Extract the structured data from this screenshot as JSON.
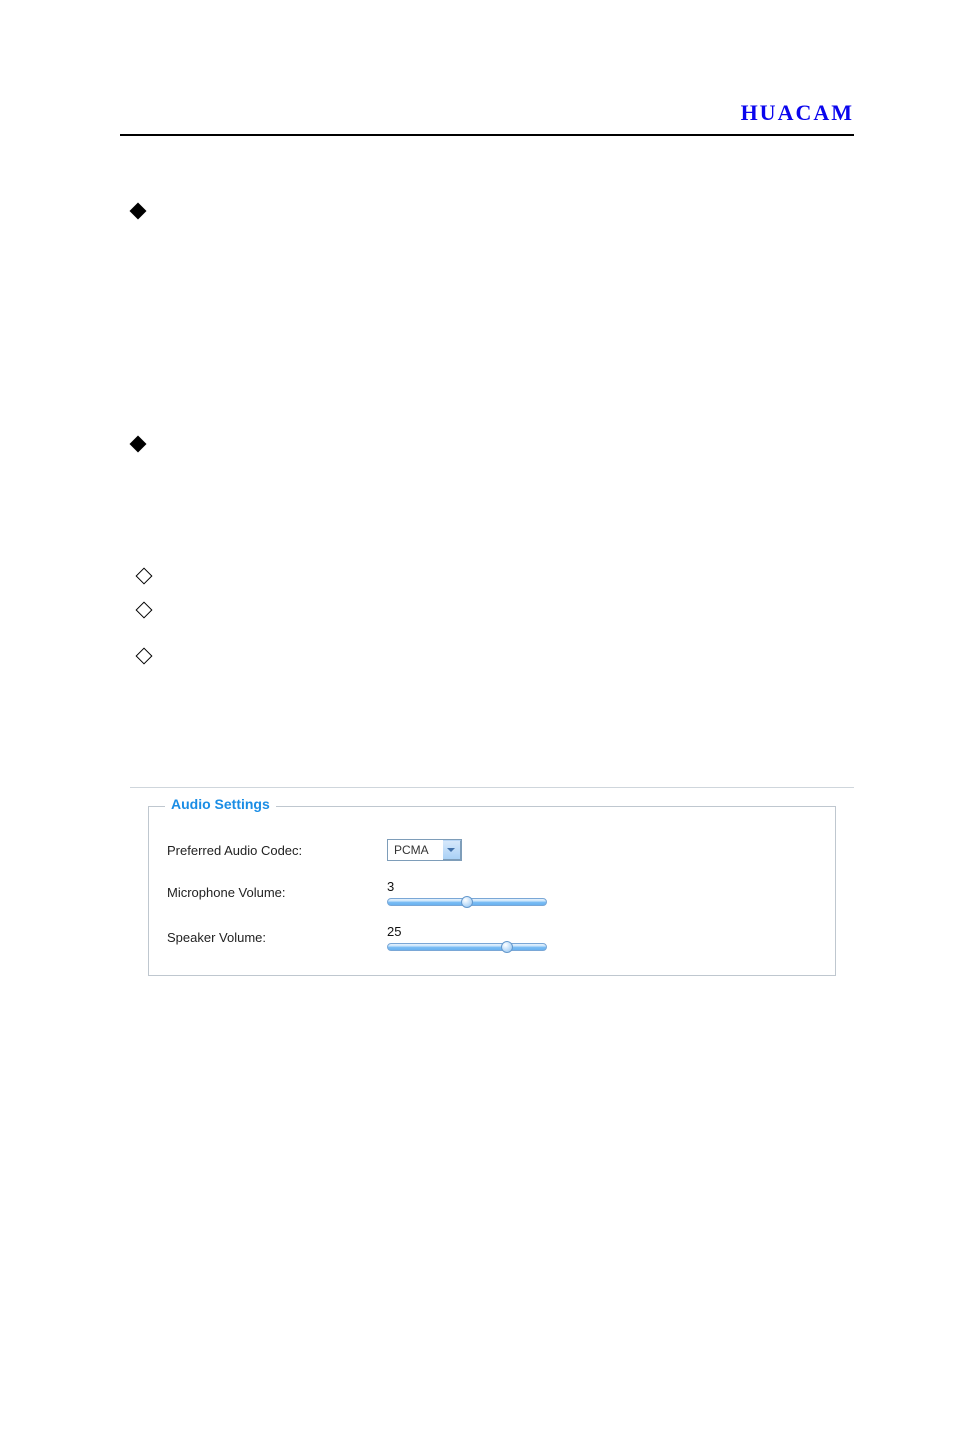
{
  "brand": "HUACAM",
  "audio_settings_embed": {
    "legend": "Audio Settings",
    "fields": {
      "codec_label": "Preferred Audio Codec:",
      "codec_value": "PCMA",
      "mic_label": "Microphone Volume:",
      "mic_value": "3",
      "mic_slider_percent": 50,
      "speaker_label": "Speaker Volume:",
      "speaker_value": "25",
      "speaker_slider_percent": 75
    }
  }
}
